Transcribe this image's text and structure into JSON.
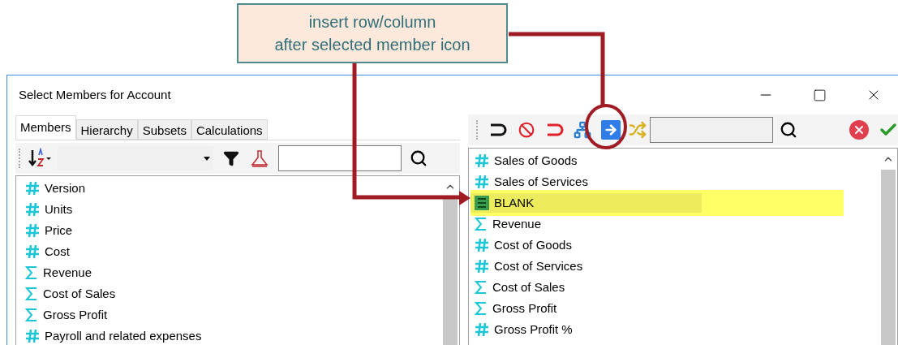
{
  "callout": {
    "lines": [
      "insert row/column",
      "after selected member icon"
    ]
  },
  "window": {
    "title": "Select Members for Account"
  },
  "tabs": [
    {
      "label": "Members",
      "selected": true
    },
    {
      "label": "Hierarchy",
      "selected": false
    },
    {
      "label": "Subsets",
      "selected": false
    },
    {
      "label": "Calculations",
      "selected": false
    }
  ],
  "left_list": {
    "items": [
      {
        "kind": "number",
        "label": "Version",
        "selected": false
      },
      {
        "kind": "number",
        "label": "Units",
        "selected": false
      },
      {
        "kind": "number",
        "label": "Price",
        "selected": false
      },
      {
        "kind": "number",
        "label": "Cost",
        "selected": false
      },
      {
        "kind": "sum",
        "label": "Revenue",
        "selected": false
      },
      {
        "kind": "sum",
        "label": "Cost of Sales",
        "selected": false
      },
      {
        "kind": "sum",
        "label": "Gross Profit",
        "selected": false
      },
      {
        "kind": "number",
        "label": "Payroll and related expenses",
        "selected": false
      }
    ]
  },
  "right_list": {
    "items": [
      {
        "kind": "number",
        "label": "Sales of Goods",
        "selected": false
      },
      {
        "kind": "number",
        "label": "Sales of Services",
        "selected": false
      },
      {
        "kind": "blank",
        "label": "BLANK",
        "selected": true
      },
      {
        "kind": "sum",
        "label": "Revenue",
        "selected": false
      },
      {
        "kind": "number",
        "label": "Cost of Goods",
        "selected": false
      },
      {
        "kind": "number",
        "label": "Cost of Services",
        "selected": false
      },
      {
        "kind": "sum",
        "label": "Cost of Sales",
        "selected": false
      },
      {
        "kind": "sum",
        "label": "Gross Profit",
        "selected": false
      },
      {
        "kind": "number",
        "label": "Gross Profit %",
        "selected": false
      }
    ]
  }
}
